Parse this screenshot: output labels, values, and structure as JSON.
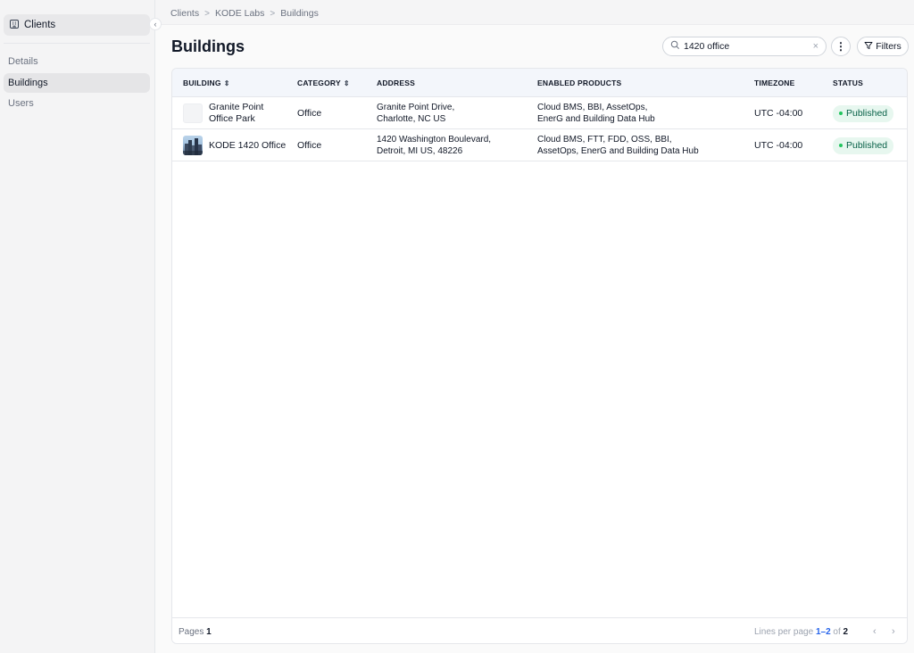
{
  "sidebar": {
    "client_label": "Clients",
    "collapse_glyph": "‹",
    "items": [
      {
        "label": "Details"
      },
      {
        "label": "Buildings"
      },
      {
        "label": "Users"
      }
    ]
  },
  "breadcrumb": [
    "Clients",
    "KODE Labs",
    "Buildings"
  ],
  "breadcrumb_sep": ">",
  "page_title": "Buildings",
  "search": {
    "value": "1420 office",
    "clear": "×"
  },
  "toolbar": {
    "more": "⋮",
    "filters": "Filters"
  },
  "table": {
    "columns": [
      "BUILDING",
      "CATEGORY",
      "ADDRESS",
      "ENABLED PRODUCTS",
      "TIMEZONE",
      "STATUS"
    ],
    "rows": [
      {
        "building": [
          "Granite Point",
          "Office Park"
        ],
        "category": "Office",
        "address": [
          "Granite Point Drive,",
          "Charlotte, NC US"
        ],
        "products": [
          "Cloud BMS, BBI, AssetOps,",
          "EnerG and Building Data Hub"
        ],
        "timezone": "UTC -04:00",
        "status": "Published"
      },
      {
        "building": [
          "KODE 1420 Office"
        ],
        "category": "Office",
        "address": [
          "1420 Washington Boulevard,",
          "Detroit, MI US, 48226"
        ],
        "products": [
          "Cloud BMS, FTT, FDD, OSS, BBI,",
          "AssetOps, EnerG and Building Data Hub"
        ],
        "timezone": "UTC -04:00",
        "status": "Published"
      }
    ]
  },
  "footer": {
    "pages_label": "Pages",
    "pages_value": "1",
    "lines_label": "Lines per page",
    "range": "1–2",
    "of": "of",
    "total": "2",
    "prev": "‹",
    "next": "›"
  },
  "colors": {
    "accent": "#2563eb",
    "published_bg": "#e7f7ef",
    "published_dot": "#22c55e"
  }
}
